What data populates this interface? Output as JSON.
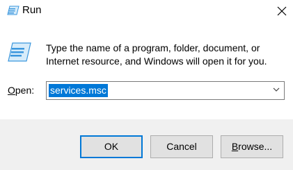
{
  "window": {
    "title": "Run",
    "title_icon": "run-icon",
    "close_icon": "close-icon"
  },
  "body": {
    "icon": "run-icon",
    "description": "Type the name of a program, folder, document, or Internet resource, and Windows will open it for you."
  },
  "open_field": {
    "label": "Open:",
    "label_mnemonic": "O",
    "label_rest": "pen:",
    "value": "services.msc",
    "dropdown_icon": "chevron-down-icon"
  },
  "buttons": {
    "ok": "OK",
    "cancel": "Cancel",
    "browse": "Browse...",
    "browse_mnemonic": "B",
    "browse_rest": "rowse..."
  },
  "colors": {
    "accent": "#0078d7",
    "footer_bg": "#f0f0f0",
    "button_bg": "#e1e1e1"
  }
}
